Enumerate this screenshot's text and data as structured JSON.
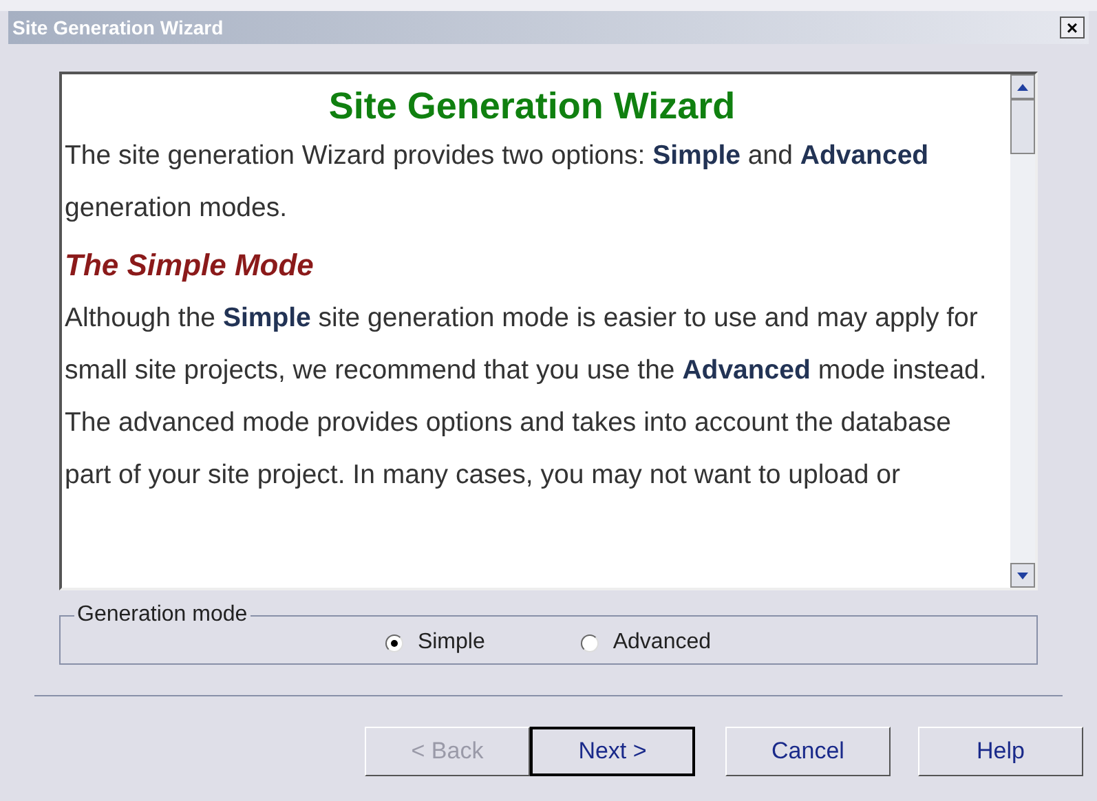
{
  "window": {
    "title": "Site Generation Wizard",
    "close": "×"
  },
  "content": {
    "heading": "Site Generation Wizard",
    "blocks": [
      {
        "kind": "paragraph",
        "text": "The site generation Wizard provides two options: **Simple** and **Advanced** generation modes."
      },
      {
        "kind": "subheading",
        "text": "The Simple Mode"
      },
      {
        "kind": "paragraph",
        "text": "Although the **Simple** site generation mode is easier to use and may apply for small site projects, we recommend that you use the **Advanced** mode instead."
      },
      {
        "kind": "paragraph",
        "text": "The advanced mode provides options and takes into account the database part of your site project. In many cases, you may not want to upload or"
      }
    ]
  },
  "generation_mode": {
    "label": "Generation mode",
    "options": [
      {
        "label": "Simple",
        "selected": true
      },
      {
        "label": "Advanced",
        "selected": false
      }
    ]
  },
  "buttons": [
    {
      "label": "< Back",
      "disabled": true,
      "default": false
    },
    {
      "label": "Next >",
      "disabled": false,
      "default": true
    },
    {
      "label": "Cancel",
      "disabled": false,
      "default": false
    },
    {
      "label": "Help",
      "disabled": false,
      "default": false
    }
  ]
}
